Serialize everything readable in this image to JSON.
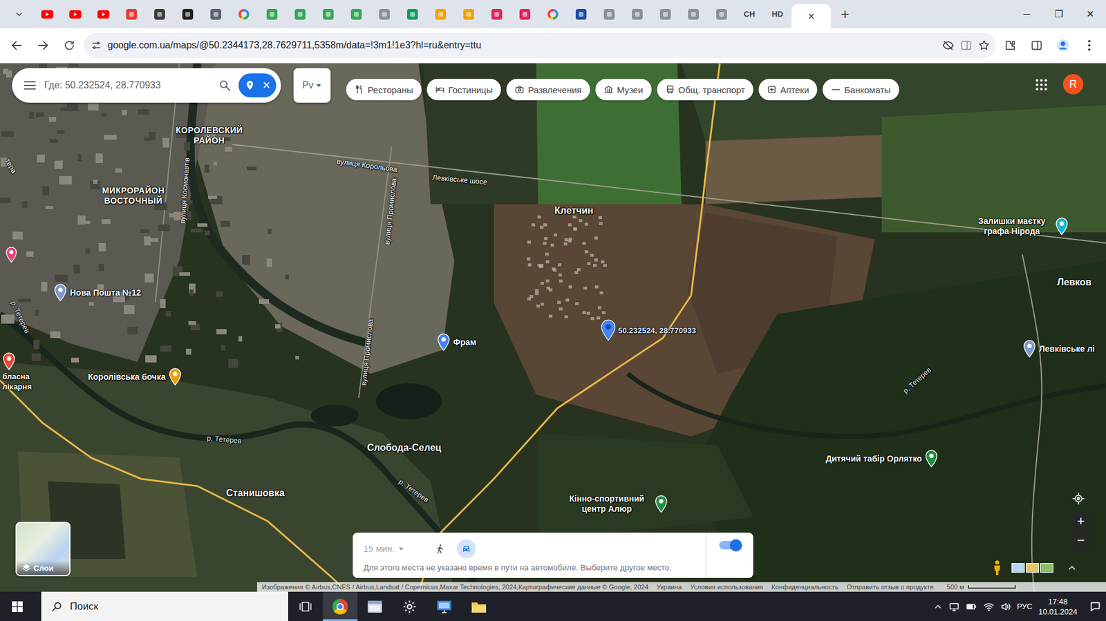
{
  "browser": {
    "tabs": [
      {
        "kind": "youtube",
        "color": "#ff0000",
        "selected": false
      },
      {
        "kind": "youtube",
        "color": "#ff0000",
        "selected": false
      },
      {
        "kind": "youtube",
        "color": "#ff0000",
        "selected": false
      },
      {
        "kind": "square",
        "color": "#e53935",
        "selected": false
      },
      {
        "kind": "square",
        "color": "#3a3a3a",
        "selected": false
      },
      {
        "kind": "square",
        "color": "#1f1f1f",
        "selected": false
      },
      {
        "kind": "square",
        "color": "#5a6070",
        "selected": false
      },
      {
        "kind": "google",
        "color": "#4285f4",
        "selected": false
      },
      {
        "kind": "square",
        "color": "#34a853",
        "selected": false
      },
      {
        "kind": "square",
        "color": "#34a853",
        "selected": false
      },
      {
        "kind": "square",
        "color": "#34a853",
        "selected": false
      },
      {
        "kind": "square",
        "color": "#34a853",
        "selected": false
      },
      {
        "kind": "square",
        "color": "#8a8f98",
        "selected": false
      },
      {
        "kind": "square",
        "color": "#0f9d58",
        "selected": false
      },
      {
        "kind": "square",
        "color": "#f4a000",
        "selected": false
      },
      {
        "kind": "square",
        "color": "#f4a000",
        "selected": false
      },
      {
        "kind": "square",
        "color": "#e0245e",
        "selected": false
      },
      {
        "kind": "square",
        "color": "#e0245e",
        "selected": false
      },
      {
        "kind": "google",
        "color": "#4285f4",
        "selected": false
      },
      {
        "kind": "square",
        "color": "#1a4fa0",
        "selected": false
      },
      {
        "kind": "square",
        "color": "#8a8f98",
        "selected": false
      },
      {
        "kind": "square",
        "color": "#8a8f98",
        "selected": false
      },
      {
        "kind": "square",
        "color": "#8a8f98",
        "selected": false
      },
      {
        "kind": "square",
        "color": "#8a8f98",
        "selected": false
      },
      {
        "kind": "square",
        "color": "#8a8f98",
        "selected": false
      },
      {
        "kind": "text",
        "label": "CH",
        "selected": false
      },
      {
        "kind": "text",
        "label": "HD",
        "selected": false
      },
      {
        "kind": "active",
        "label": "×",
        "selected": true
      }
    ],
    "new_tab": "+",
    "window_controls": [
      "─",
      "❐",
      "✕"
    ],
    "url": "google.com.ua/maps/@50.2344173,28.7629711,5358m/data=!3m1!1e3?hl=ru&entry=ttu"
  },
  "maps": {
    "search": {
      "value": "Где: 50.232524, 28.770933",
      "close": "×"
    },
    "lang_box": "Рv",
    "chips": [
      "Рестораны",
      "Гостиницы",
      "Развлечения",
      "Музеи",
      "Общ. транспорт",
      "Аптеки",
      "Банкоматы"
    ],
    "avatar": "R",
    "labels": [
      {
        "text": "КОРОЛЕВСКИЙ РАЙОН",
        "kind": "district"
      },
      {
        "text": "МИКРОРАЙОН ВОСТОЧНЫЙ",
        "kind": "district"
      },
      {
        "text": "Клетчин",
        "kind": "place"
      },
      {
        "text": "Слобода-Селец",
        "kind": "place"
      },
      {
        "text": "Станишовка",
        "kind": "place"
      },
      {
        "text": "Левков",
        "kind": "place"
      },
      {
        "text": "Левківське шосе",
        "kind": "street"
      },
      {
        "text": "вулиця Корольова",
        "kind": "street"
      },
      {
        "text": "вулиця Промислова",
        "kind": "street"
      },
      {
        "text": "вулиця Промислова",
        "kind": "street"
      },
      {
        "text": "вулиця Космонавтів",
        "kind": "street"
      },
      {
        "text": "р. Тетерев",
        "kind": "river"
      },
      {
        "text": "р. Тетерев",
        "kind": "river"
      },
      {
        "text": "р. Тетерев",
        "kind": "river"
      },
      {
        "text": "р. Тетерев",
        "kind": "river"
      },
      {
        "text": "тера",
        "kind": "street"
      }
    ],
    "pois": [
      {
        "text": "Нова Пошта №12",
        "color": "#7b9acc"
      },
      {
        "text": "Фрам",
        "color": "#4285f4"
      },
      {
        "text": "Королівська бочка",
        "color": "#f29900"
      },
      {
        "text": "Кінно-спортивний центр Алюр",
        "color": "#1e8e3e"
      },
      {
        "text": "Дитячий табір Орлятко",
        "color": "#1e8e3e"
      },
      {
        "text": "Залишки маєтку графа Нірода",
        "color": "#12b5cb"
      },
      {
        "text": "Левківське лі",
        "color": "#7b9acc"
      },
      {
        "text": "бласна лікарня",
        "color": "#ea4335"
      }
    ],
    "extra_pins": [
      {
        "color": "#e8437d"
      }
    ],
    "selected_pin": {
      "label": "50.232524, 28.770933"
    },
    "travel": {
      "time": "15 мин.",
      "modes": [
        {
          "kind": "walk",
          "selected": false
        },
        {
          "kind": "car",
          "selected": true
        }
      ],
      "toggle_on": true,
      "message": "Для этого места не указано время в пути на автомобиле. Выберите другое место."
    },
    "layers": "Слои",
    "zoom": [
      "+",
      "−"
    ],
    "attribution": [
      "Изображения © Airbus,CNES / Airbus,Landsat / Copernicus,Maxar Technologies, 2024,Картографические данные © Google, 2024",
      "Украина",
      "Условия использования",
      "Конфиденциальность",
      "Отправить отзыв о продукте"
    ],
    "scale": "500 м"
  },
  "taskbar": {
    "search": "Поиск",
    "apps": [
      {
        "kind": "chrome",
        "selected": true
      },
      {
        "kind": "window",
        "selected": false
      },
      {
        "kind": "gear",
        "selected": false
      },
      {
        "kind": "monitor",
        "selected": false
      },
      {
        "kind": "folder",
        "selected": false
      }
    ],
    "lang": "РУС",
    "time": "17:48",
    "date": "10.01.2024"
  }
}
